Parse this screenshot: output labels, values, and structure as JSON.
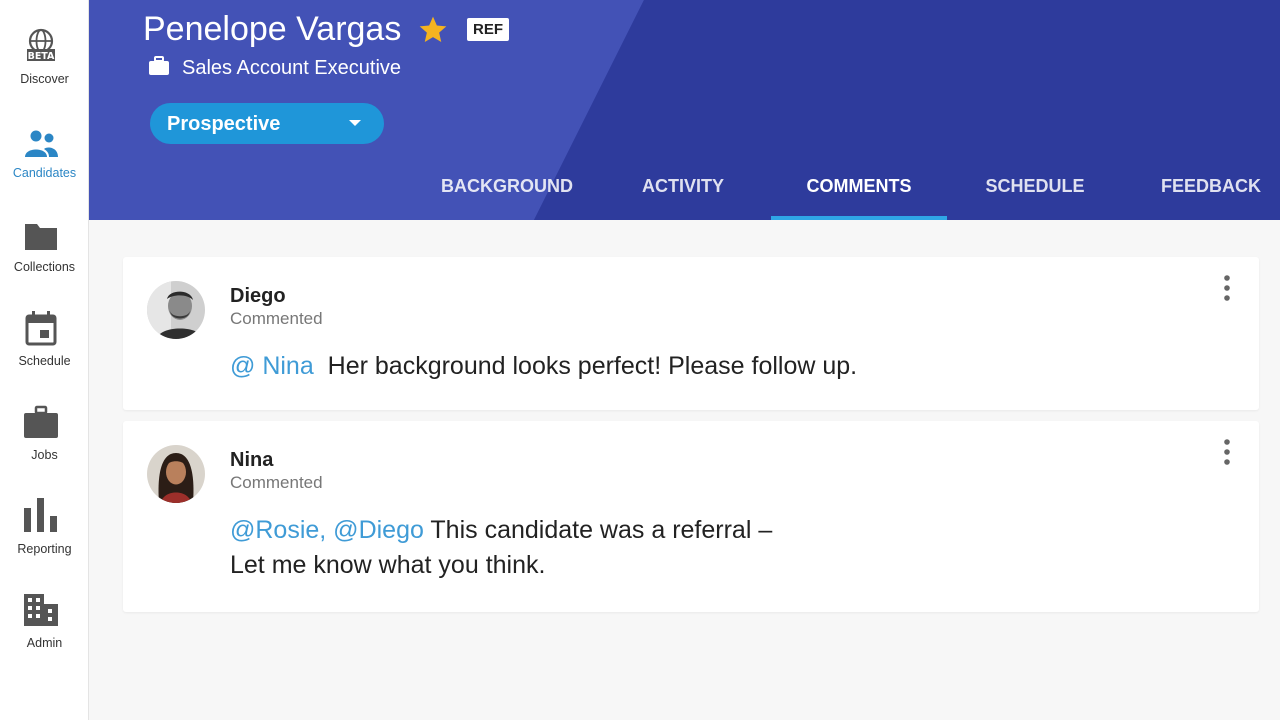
{
  "sidebar": {
    "items": [
      {
        "label": "Discover",
        "icon": "globe-beta-icon",
        "badge": "BETA"
      },
      {
        "label": "Candidates",
        "icon": "people-icon"
      },
      {
        "label": "Collections",
        "icon": "folder-icon"
      },
      {
        "label": "Schedule",
        "icon": "calendar-icon"
      },
      {
        "label": "Jobs",
        "icon": "briefcase-icon"
      },
      {
        "label": "Reporting",
        "icon": "bar-chart-icon"
      },
      {
        "label": "Admin",
        "icon": "building-icon"
      }
    ],
    "active": "Candidates"
  },
  "candidate": {
    "name": "Penelope Vargas",
    "badge": "REF",
    "job_title": "Sales Account Executive",
    "status": "Prospective"
  },
  "tabs": [
    {
      "label": "BACKGROUND"
    },
    {
      "label": "ACTIVITY"
    },
    {
      "label": "COMMENTS"
    },
    {
      "label": "SCHEDULE"
    },
    {
      "label": "FEEDBACK"
    }
  ],
  "active_tab": "COMMENTS",
  "comments": [
    {
      "author": "Diego",
      "action": "Commented",
      "mentions": "@ Nina",
      "text": "Her background looks perfect! Please follow up."
    },
    {
      "author": "Nina",
      "action": "Commented",
      "mentions": "@Rosie, @Diego",
      "text": "This candidate was a referral –",
      "text_line2": "Let me know what you think."
    }
  ],
  "colors": {
    "header": "#2f3c9e",
    "accent": "#2b86c5",
    "status_pill": "#1f96d9",
    "mention": "#3f9bd6",
    "star": "#f5b320"
  }
}
